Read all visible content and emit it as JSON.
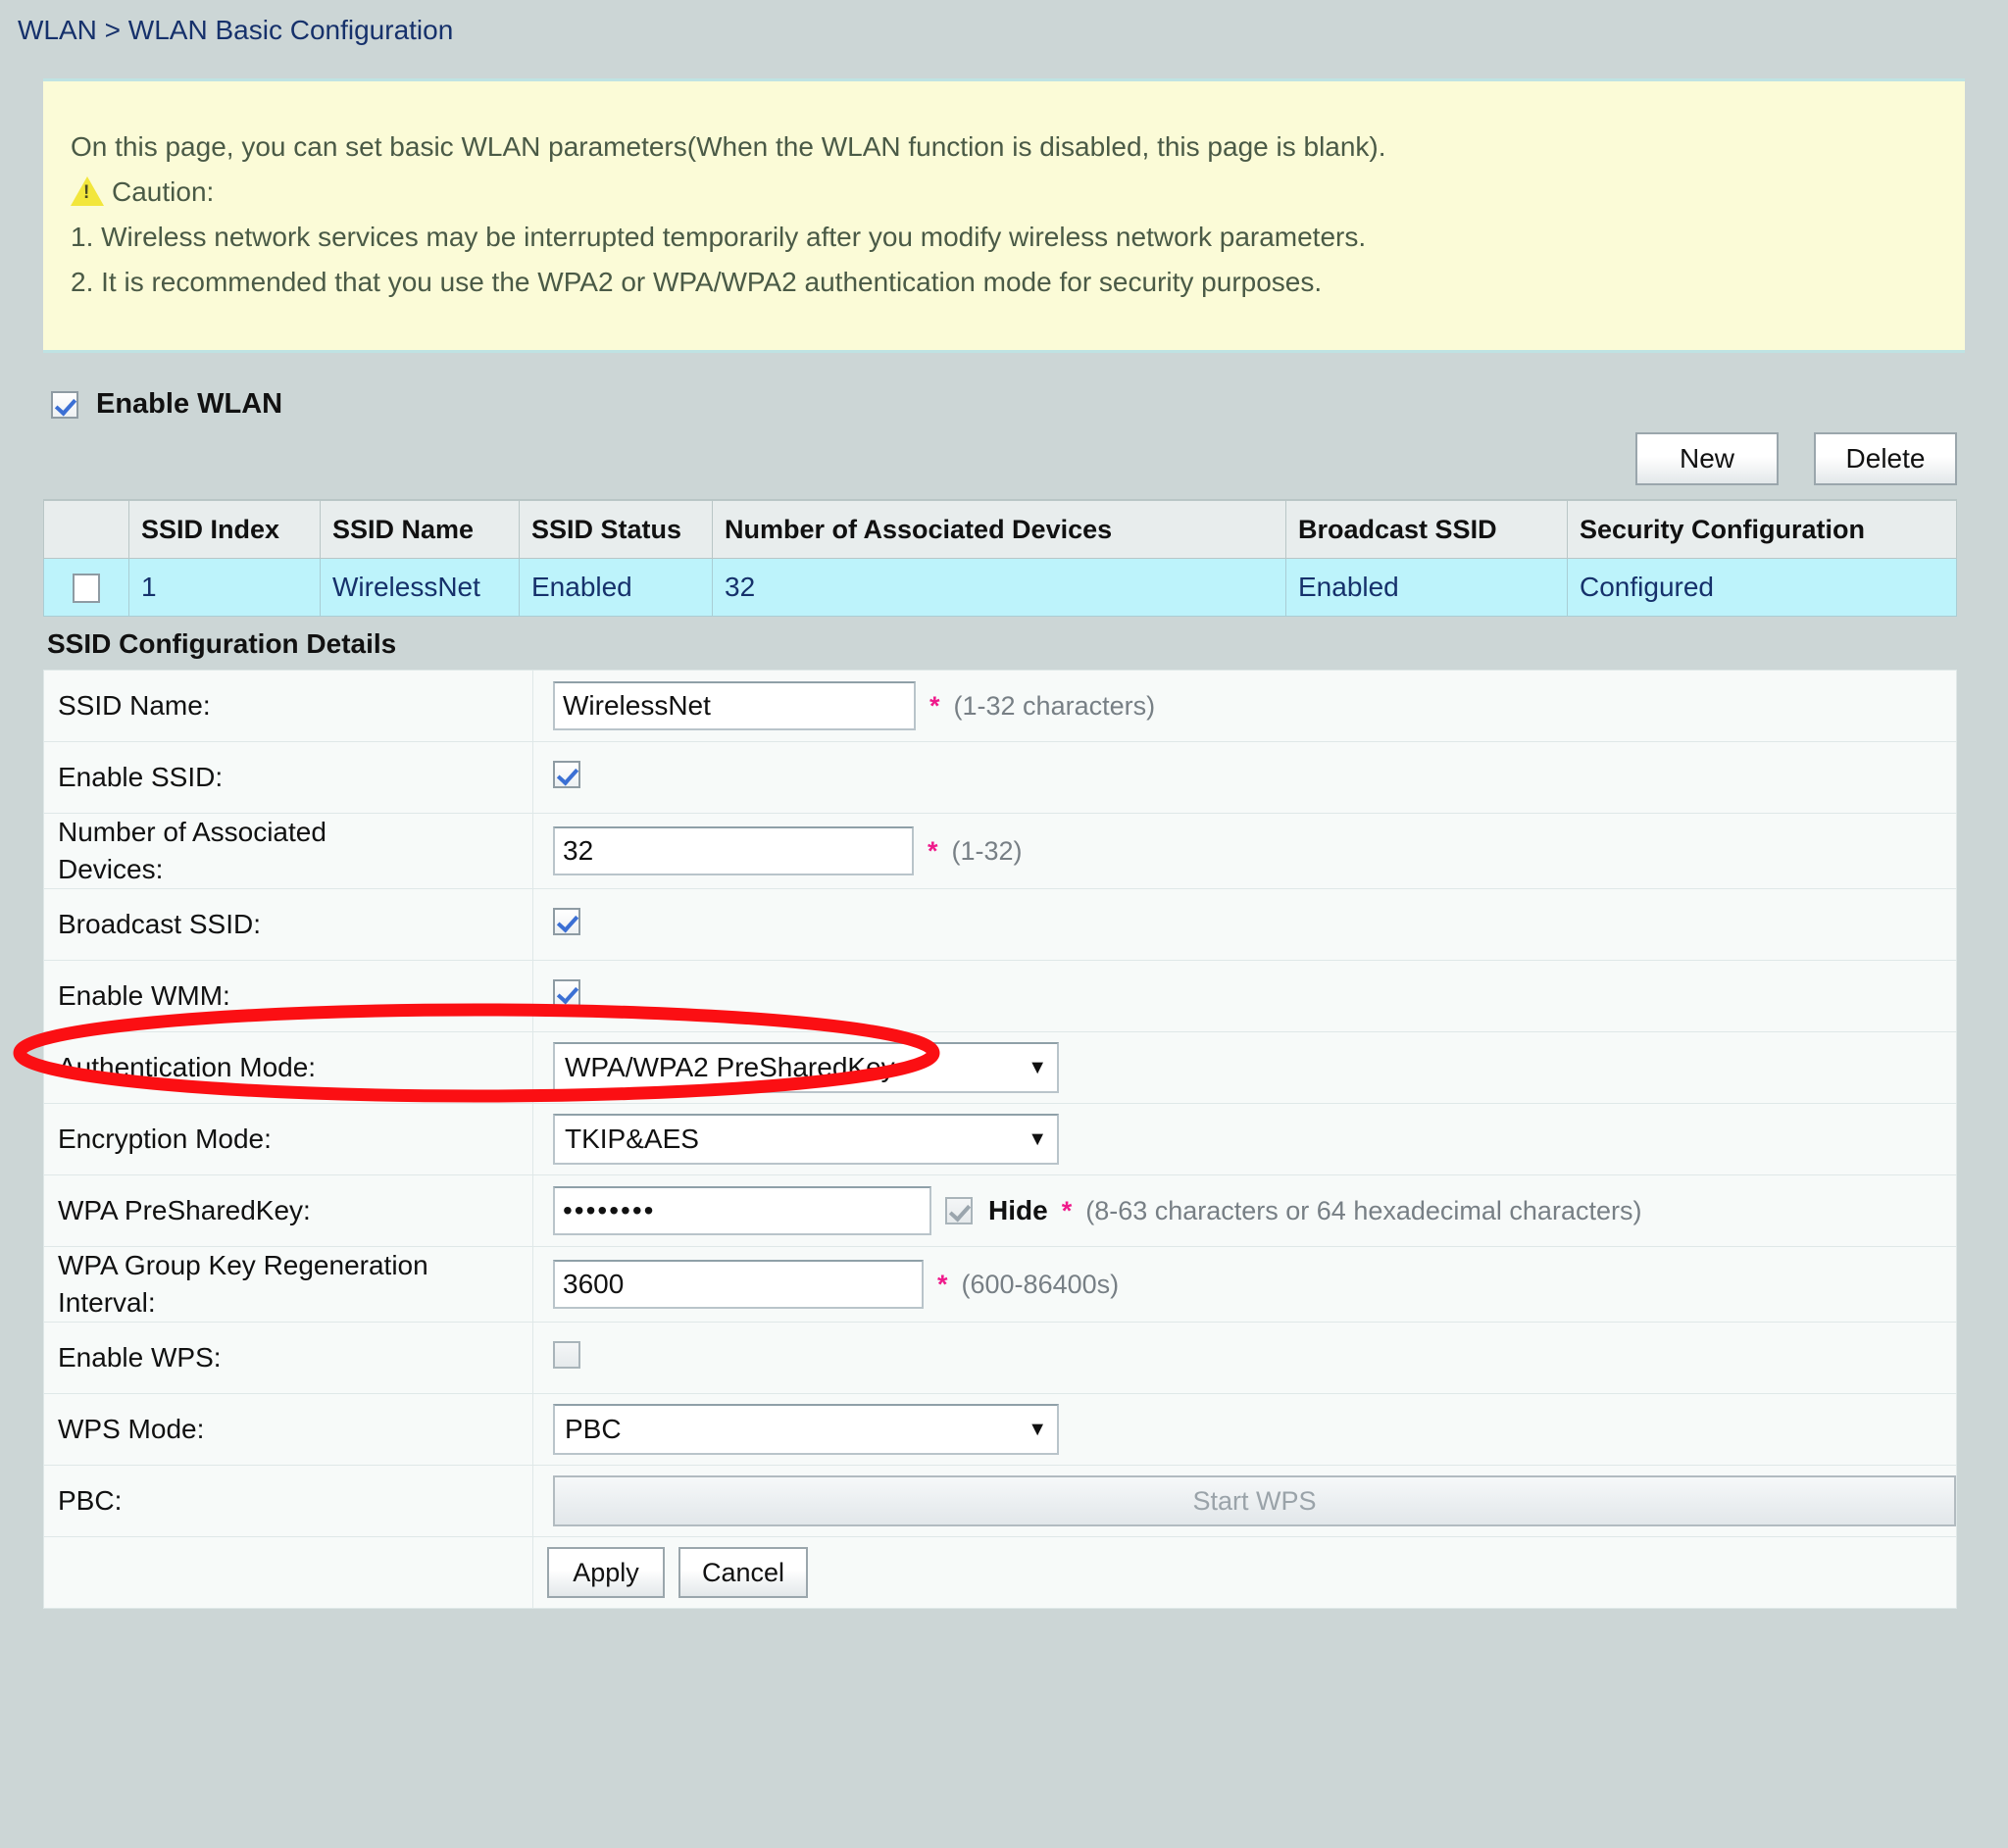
{
  "breadcrumb": {
    "text": "WLAN > WLAN Basic Configuration"
  },
  "notice": {
    "intro": "On this page, you can set basic WLAN parameters(When the WLAN function is disabled, this page is blank).",
    "caution_label": "Caution:",
    "caution_icon": "warning-triangle-icon",
    "items": [
      "1. Wireless network services may be interrupted temporarily after you modify wireless network parameters.",
      "2. It is recommended that you use the WPA2 or WPA/WPA2 authentication mode for security purposes."
    ]
  },
  "enable_wlan": {
    "label": "Enable WLAN",
    "checked": true
  },
  "toolbar": {
    "new_label": "New",
    "delete_label": "Delete"
  },
  "ssid_table": {
    "headers": [
      "",
      "SSID Index",
      "SSID Name",
      "SSID Status",
      "Number of Associated Devices",
      "Broadcast SSID",
      "Security Configuration"
    ],
    "rows": [
      {
        "selected": false,
        "index": "1",
        "name": "WirelessNet",
        "status": "Enabled",
        "associated_devices": "32",
        "broadcast_ssid": "Enabled",
        "security": "Configured"
      }
    ]
  },
  "details": {
    "title": "SSID Configuration Details",
    "ssid_name": {
      "label": "SSID Name:",
      "value": "WirelessNet",
      "required_mark": "*",
      "hint": "(1-32 characters)"
    },
    "enable_ssid": {
      "label": "Enable SSID:",
      "checked": true
    },
    "associated_devices": {
      "label": "Number of Associated Devices:",
      "label_line1": "Number of Associated",
      "label_line2": "Devices:",
      "value": "32",
      "required_mark": "*",
      "hint": "(1-32)"
    },
    "broadcast_ssid": {
      "label": "Broadcast SSID:",
      "checked": true,
      "highlighted": true
    },
    "enable_wmm": {
      "label": "Enable WMM:",
      "checked": true
    },
    "authentication_mode": {
      "label": "Authentication Mode:",
      "value": "WPA/WPA2 PreSharedKey",
      "caret": "▼"
    },
    "encryption_mode": {
      "label": "Encryption Mode:",
      "value": "TKIP&AES",
      "caret": "▼"
    },
    "wpa_presharedkey": {
      "label": "WPA PreSharedKey:",
      "value": "••••••••",
      "hide_label": "Hide",
      "hide_checked": true,
      "required_mark": "*",
      "hint": "(8-63 characters or 64 hexadecimal characters)"
    },
    "group_key_interval": {
      "label_line1": "WPA Group Key Regeneration",
      "label_line2": "Interval:",
      "value": "3600",
      "required_mark": "*",
      "hint": "(600-86400s)"
    },
    "enable_wps": {
      "label": "Enable WPS:",
      "checked": false
    },
    "wps_mode": {
      "label": "WPS Mode:",
      "value": "PBC",
      "caret": "▼"
    },
    "pbc": {
      "label": "PBC:",
      "button_label": "Start WPS",
      "disabled": true
    },
    "actions": {
      "apply_label": "Apply",
      "cancel_label": "Cancel"
    }
  },
  "annotation": {
    "type": "red-ellipse-highlight",
    "target": "broadcast-ssid-row",
    "color": "#fb0f13"
  }
}
